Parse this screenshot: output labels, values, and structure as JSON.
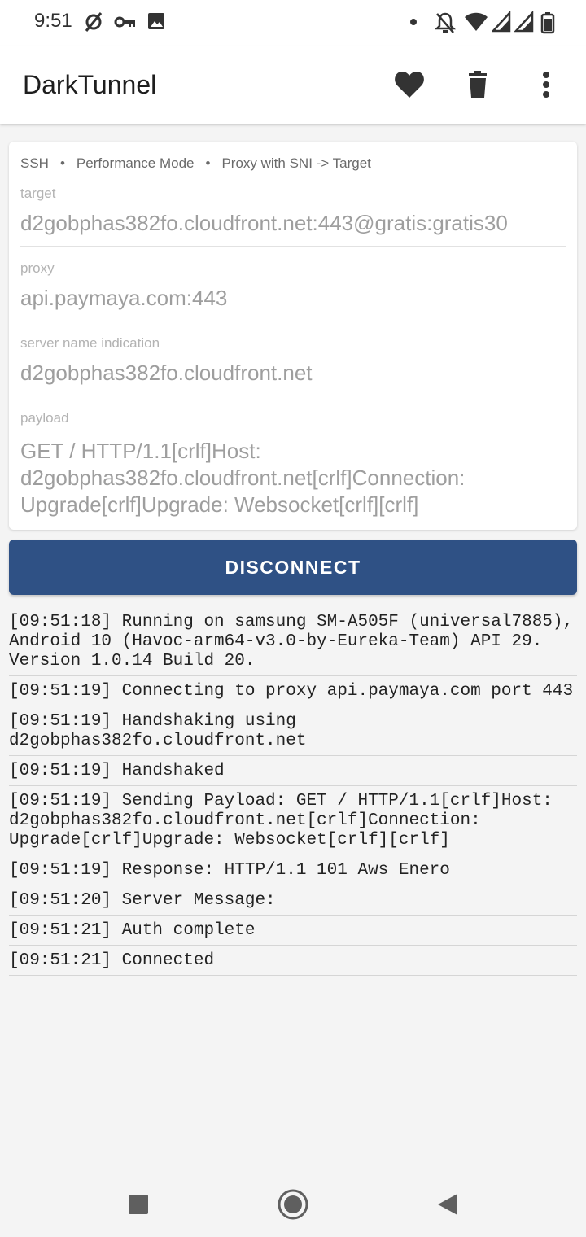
{
  "status_bar": {
    "time": "9:51",
    "left_icons": [
      "no-sync-icon",
      "vpn-key-icon",
      "image-icon"
    ],
    "right_icons": [
      "notification-dot-icon",
      "mute-icon",
      "wifi-icon",
      "signal-icon",
      "signal-icon",
      "battery-icon"
    ]
  },
  "app_bar": {
    "title": "DarkTunnel",
    "actions": [
      "favorite-icon",
      "delete-icon",
      "more-vert-icon"
    ]
  },
  "config": {
    "modes": [
      "SSH",
      "Performance Mode",
      "Proxy with SNI -> Target"
    ],
    "separator": "•",
    "target_label": "target",
    "target_value": "d2gobphas382fo.cloudfront.net:443@gratis:gratis30",
    "proxy_label": "proxy",
    "proxy_value": "api.paymaya.com:443",
    "sni_label": "server name indication",
    "sni_value": "d2gobphas382fo.cloudfront.net",
    "payload_label": "payload",
    "payload_value": "GET / HTTP/1.1[crlf]Host: d2gobphas382fo.cloudfront.net[crlf]Connection: Upgrade[crlf]Upgrade: Websocket[crlf][crlf]"
  },
  "button": {
    "disconnect_label": "DISCONNECT",
    "color": "#2f5185"
  },
  "log": [
    "[09:51:18] Running on samsung SM-A505F (universal7885), Android 10 (Havoc-arm64-v3.0-by-Eureka-Team) API 29. Version 1.0.14 Build 20.",
    "[09:51:19] Connecting to proxy api.paymaya.com port 443",
    "[09:51:19] Handshaking using d2gobphas382fo.cloudfront.net",
    "[09:51:19] Handshaked",
    "[09:51:19] Sending Payload: GET / HTTP/1.1[crlf]Host: d2gobphas382fo.cloudfront.net[crlf]Connection: Upgrade[crlf]Upgrade: Websocket[crlf][crlf]",
    "[09:51:19] Response: HTTP/1.1 101 Aws Enero",
    "[09:51:20] Server Message:",
    "[09:51:21] Auth complete",
    "[09:51:21] Connected"
  ],
  "nav_bar": {
    "buttons": [
      "recents-icon",
      "home-icon",
      "back-icon"
    ]
  }
}
